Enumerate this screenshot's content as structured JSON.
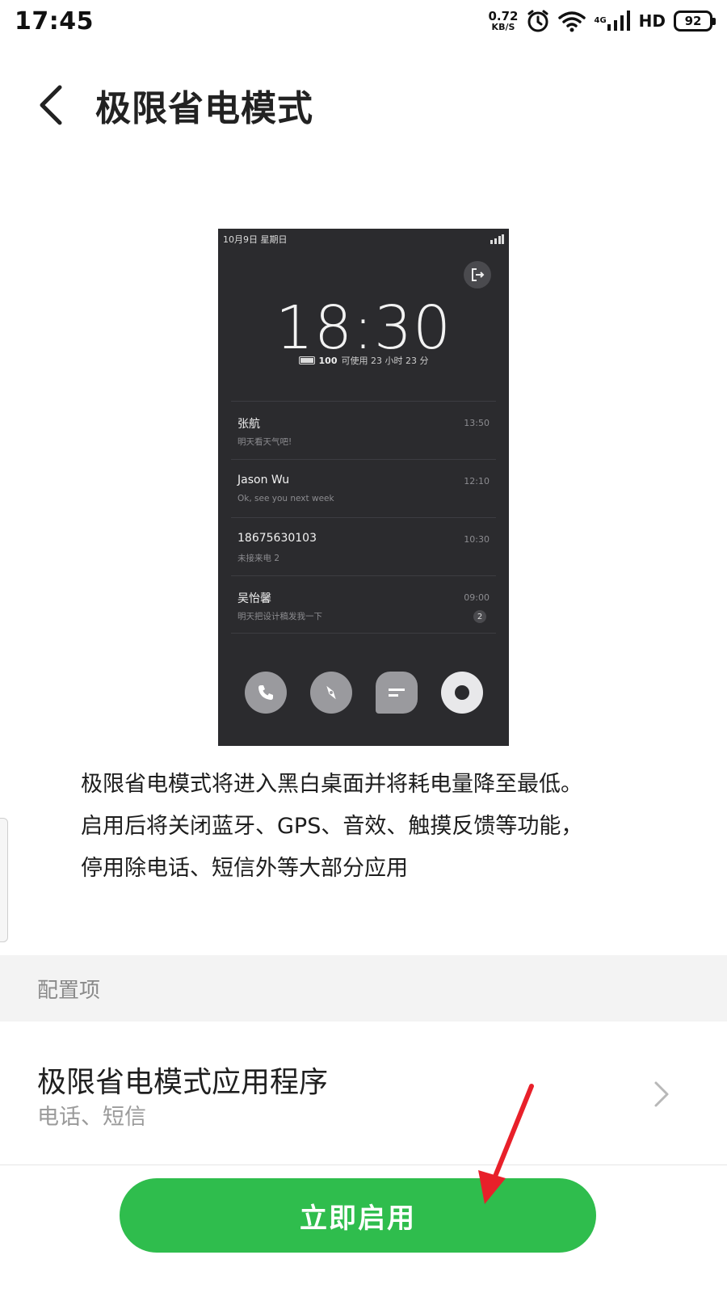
{
  "status_bar": {
    "time": "17:45",
    "net_speed_value": "0.72",
    "net_speed_unit": "KB/S",
    "net_type": "4G",
    "hd": "HD",
    "battery": "92"
  },
  "header": {
    "title": "极限省电模式"
  },
  "preview": {
    "date": "10月9日 星期日",
    "clock": "18:30",
    "battery_pct": "100",
    "battery_text": "可使用 23 小时 23 分",
    "messages": [
      {
        "name": "张航",
        "text": "明天看天气吧!",
        "time": "13:50"
      },
      {
        "name": "Jason Wu",
        "text": "Ok, see you next week",
        "time": "12:10"
      },
      {
        "name": "18675630103",
        "text": "未接来电 2",
        "time": "10:30"
      },
      {
        "name": "吴怡馨",
        "text": "明天把设计稿发我一下",
        "time": "09:00",
        "badge": "2"
      }
    ]
  },
  "description": {
    "line1": "极限省电模式将进入黑白桌面并将耗电量降至最低。",
    "line2": "启用后将关闭蓝牙、GPS、音效、触摸反馈等功能，",
    "line3": "停用除电话、短信外等大部分应用"
  },
  "config_section": {
    "label": "配置项",
    "row_title": "极限省电模式应用程序",
    "row_subtitle": "电话、短信"
  },
  "actions": {
    "enable_label": "立即启用"
  },
  "colors": {
    "accent_green": "#2fbd4d",
    "annotation_red": "#e8202a",
    "preview_bg": "#2b2b2e"
  }
}
